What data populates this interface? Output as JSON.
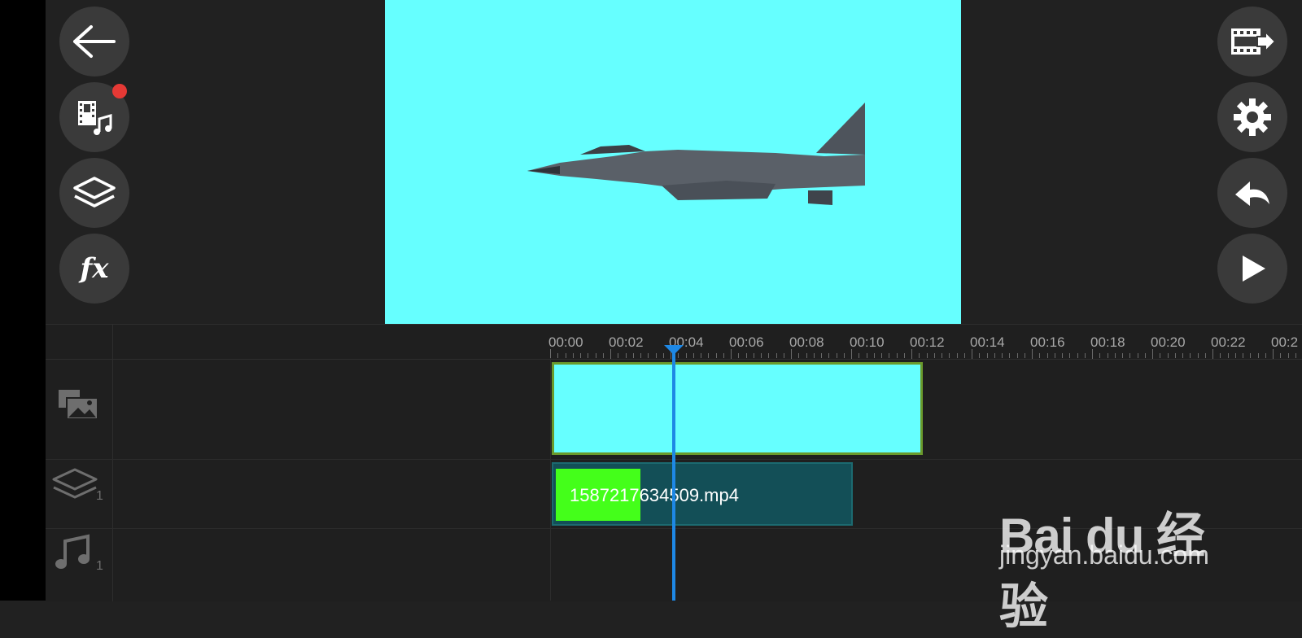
{
  "toolbar_left": {
    "buttons": [
      "back",
      "media",
      "layers",
      "effects"
    ],
    "media_badge": true,
    "fx_label": "fx"
  },
  "toolbar_right": {
    "buttons": [
      "export",
      "settings",
      "undo",
      "play"
    ]
  },
  "timeline": {
    "ruler_labels": [
      "00:00",
      "00:02",
      "00:04",
      "00:06",
      "00:08",
      "00:10",
      "00:12",
      "00:14",
      "00:16",
      "00:18",
      "00:20",
      "00:22",
      "00:2"
    ],
    "video_track_clip": {
      "color": "#66ffff"
    },
    "overlay_track_count": "1",
    "audio_track_count": "1",
    "overlay_clip": {
      "name": "1587217634509.mp4",
      "thumb_color": "#44ff1a"
    }
  },
  "preview": {
    "background": "#66ffff"
  },
  "watermark": {
    "logo": "Bai du 经验",
    "url": "jingyan.baidu.com"
  }
}
